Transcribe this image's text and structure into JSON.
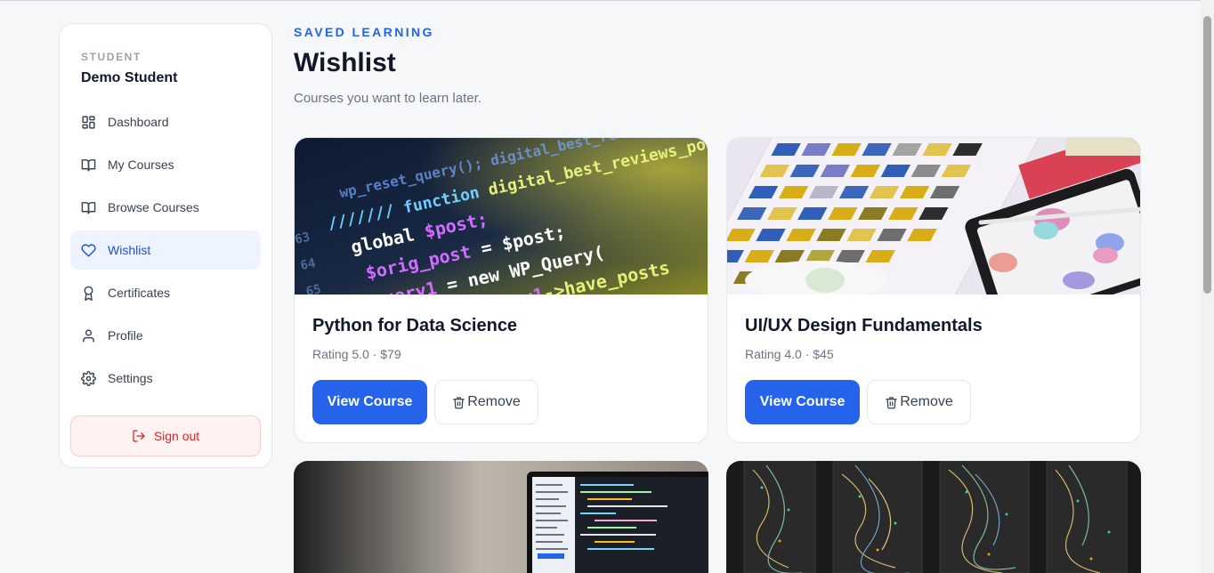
{
  "sidebar": {
    "role_label": "STUDENT",
    "user_name": "Demo Student",
    "items": [
      {
        "label": "Dashboard",
        "icon": "dashboard-grid-icon"
      },
      {
        "label": "My Courses",
        "icon": "open-book-icon"
      },
      {
        "label": "Browse Courses",
        "icon": "open-book-icon"
      },
      {
        "label": "Wishlist",
        "icon": "heart-icon",
        "active": true
      },
      {
        "label": "Certificates",
        "icon": "award-icon"
      },
      {
        "label": "Profile",
        "icon": "user-icon"
      },
      {
        "label": "Settings",
        "icon": "gear-icon"
      }
    ],
    "signout_label": "Sign out"
  },
  "header": {
    "eyebrow": "SAVED LEARNING",
    "title": "Wishlist",
    "subtitle": "Courses you want to learn later."
  },
  "courses": [
    {
      "title": "Python for Data Science",
      "meta": "Rating 5.0 · $79",
      "view_label": "View Course",
      "remove_label": "Remove"
    },
    {
      "title": "UI/UX Design Fundamentals",
      "meta": "Rating 4.0 · $45",
      "view_label": "View Course",
      "remove_label": "Remove"
    }
  ],
  "colors": {
    "accent": "#2563eb",
    "active_bg": "#eef4ff",
    "danger": "#dc2626",
    "danger_bg": "#fef2f2"
  }
}
